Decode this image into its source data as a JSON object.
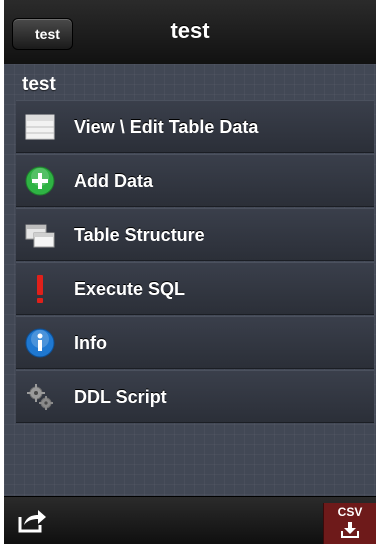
{
  "navbar": {
    "back_label": "test",
    "title": "test"
  },
  "section": {
    "header": "test"
  },
  "menu": [
    {
      "label": "View \\ Edit Table Data",
      "icon": "table-icon"
    },
    {
      "label": "Add Data",
      "icon": "add-icon"
    },
    {
      "label": "Table Structure",
      "icon": "structure-icon"
    },
    {
      "label": "Execute SQL",
      "icon": "exclamation-icon"
    },
    {
      "label": "Info",
      "icon": "info-icon"
    },
    {
      "label": "DDL Script",
      "icon": "gears-icon"
    }
  ],
  "toolbar": {
    "csv_label": "CSV",
    "share_icon": "share-icon",
    "download_icon": "download-icon"
  },
  "colors": {
    "background": "#424855",
    "navbar": "#111111",
    "add_green": "#2fb344",
    "execute_red": "#e0201a",
    "info_blue": "#1f78d1",
    "csv_red": "#6e1a1a"
  }
}
